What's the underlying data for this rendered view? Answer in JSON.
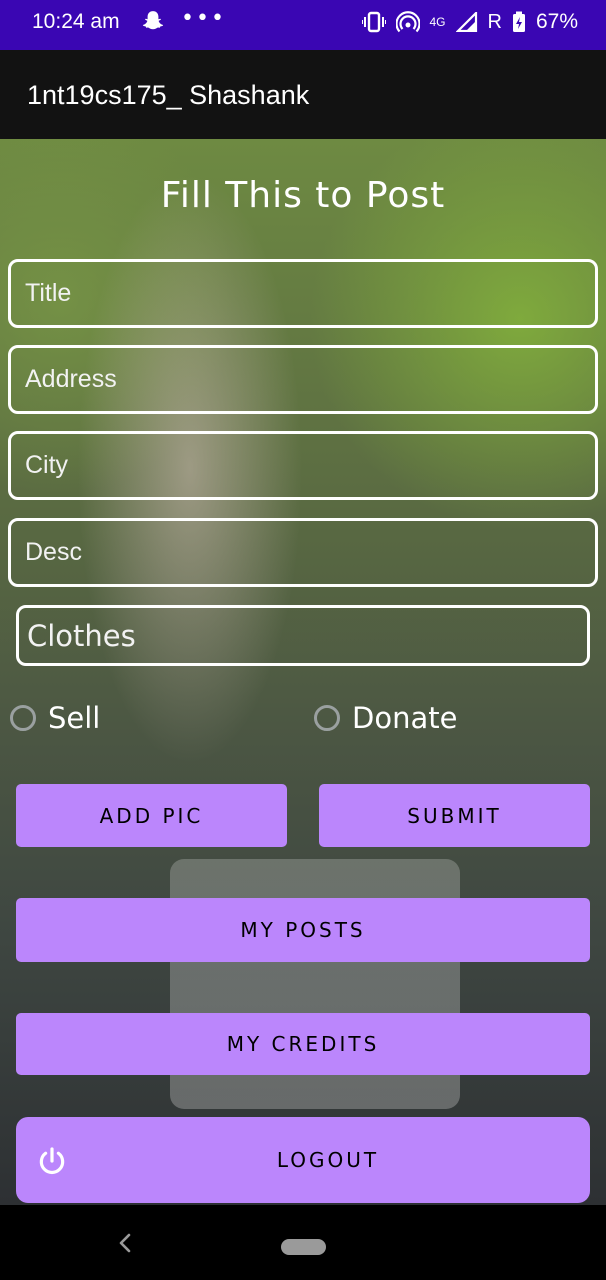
{
  "status_bar": {
    "time": "10:24 am",
    "notification_dots": "•••",
    "network_label": "4G",
    "roaming_label": "R",
    "battery": "67%"
  },
  "app_bar": {
    "title": "1nt19cs175_ Shashank"
  },
  "form": {
    "heading": "Fill This to Post",
    "fields": [
      {
        "name": "title",
        "placeholder": "Title"
      },
      {
        "name": "address",
        "placeholder": "Address"
      },
      {
        "name": "city",
        "placeholder": "City"
      },
      {
        "name": "desc",
        "placeholder": "Desc"
      }
    ],
    "category": {
      "value": "Clothes"
    },
    "radio_options": [
      {
        "label": "Sell",
        "checked": false
      },
      {
        "label": "Donate",
        "checked": false
      }
    ]
  },
  "buttons": {
    "add_pic": "ADD PIC",
    "submit": "SUBMIT",
    "my_posts": "MY POSTS",
    "my_credits": "MY CREDITS",
    "logout": "LOGOUT"
  },
  "colors": {
    "status_bar": "#3a06b3",
    "app_bar": "#121212",
    "button": "#bb86fc"
  },
  "icons": {
    "status_left": [
      "snapchat-icon",
      "more-dots-icon"
    ],
    "status_right": [
      "vibrate-icon",
      "hotspot-icon",
      "signal-icon",
      "battery-icon"
    ],
    "logout": "power-icon",
    "navigation": [
      "back-icon",
      "home-pill-icon"
    ]
  }
}
